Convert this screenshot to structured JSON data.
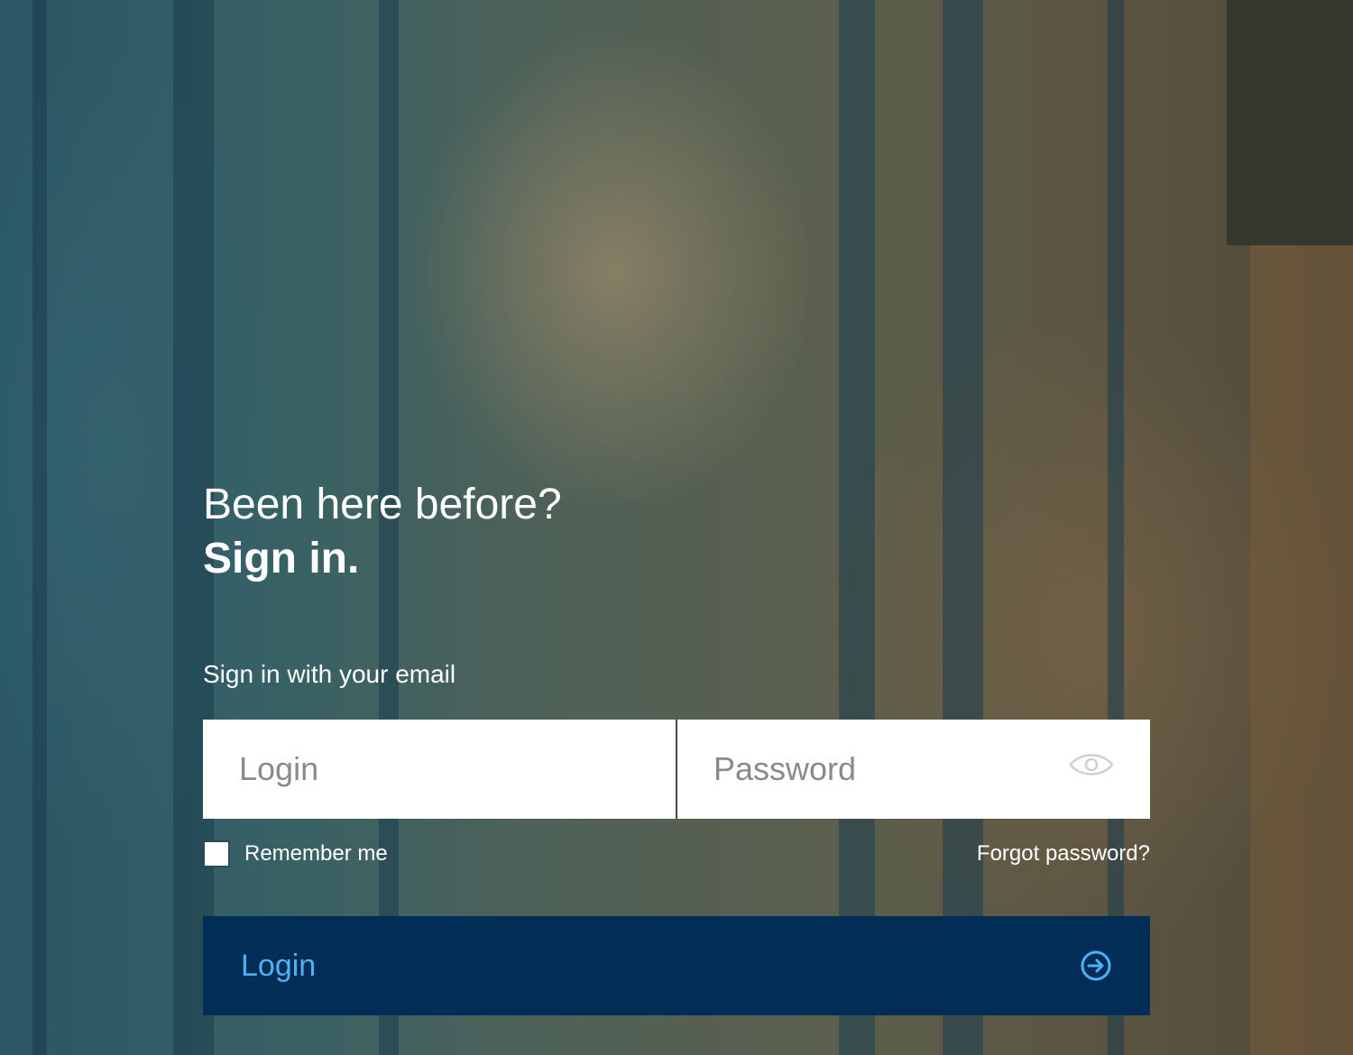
{
  "heading": {
    "line1": "Been here before?",
    "line2": "Sign in."
  },
  "subtitle": "Sign in with your email",
  "fields": {
    "login_placeholder": "Login",
    "password_placeholder": "Password"
  },
  "options": {
    "remember_label": "Remember me",
    "remember_checked": false,
    "forgot_label": "Forgot password?"
  },
  "button": {
    "label": "Login",
    "icon": "arrow-circle-right-icon"
  },
  "icons": {
    "password_toggle": "eye-icon"
  },
  "colors": {
    "button_bg": "#012d56",
    "button_text": "#4fb2f0",
    "heading_text": "#ffffff"
  }
}
